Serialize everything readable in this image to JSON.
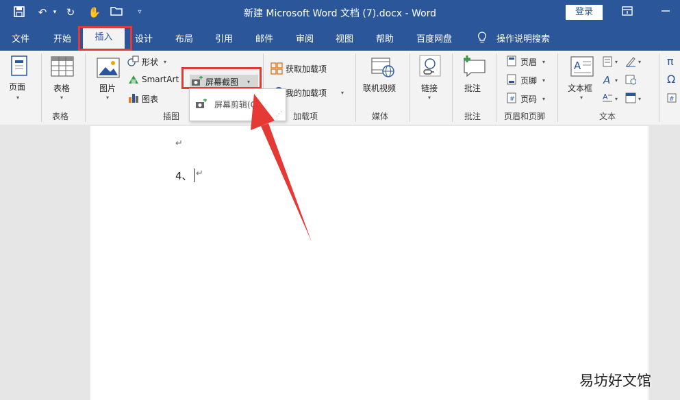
{
  "window": {
    "title": "新建 Microsoft Word 文档 (7).docx  -  Word",
    "login_label": "登录"
  },
  "quick_access": {
    "icons": [
      "save-icon",
      "undo-icon",
      "redo-icon",
      "touch-mode-icon",
      "open-folder-icon",
      "customize-caret-icon"
    ]
  },
  "menu": {
    "tabs": [
      "文件",
      "开始",
      "插入",
      "设计",
      "布局",
      "引用",
      "邮件",
      "审阅",
      "视图",
      "帮助",
      "百度网盘"
    ],
    "active_tab": "插入",
    "tell_me": "操作说明搜索"
  },
  "ribbon": {
    "pages": {
      "label": "页面"
    },
    "tables": {
      "table_label": "表格",
      "group_label": "表格"
    },
    "illustrations": {
      "picture_label": "图片",
      "shapes_label": "形状",
      "smartart_label": "SmartArt",
      "chart_label": "图表",
      "screenshot_label": "屏幕截图",
      "group_label": "插图"
    },
    "addins": {
      "get_label": "获取加载项",
      "my_label": "我的加载项",
      "group_label": "加载项"
    },
    "media": {
      "video_label": "联机视频",
      "group_label": "媒体"
    },
    "links": {
      "link_label": "链接"
    },
    "comments": {
      "comment_label": "批注",
      "group_label": "批注"
    },
    "header_footer": {
      "header_label": "页眉",
      "footer_label": "页脚",
      "page_number_label": "页码",
      "group_label": "页眉和页脚"
    },
    "text": {
      "textbox_label": "文本框",
      "group_label": "文本"
    },
    "symbols": {
      "equation_glyph": "π",
      "symbol_glyph": "Ω"
    }
  },
  "dropdown": {
    "screen_clipping_label": "屏幕剪辑(C)"
  },
  "document": {
    "line1": "↵",
    "line2": "4、"
  },
  "watermark": "易坊好文馆",
  "colors": {
    "accent": "#2b579a",
    "highlight": "#e53935"
  }
}
